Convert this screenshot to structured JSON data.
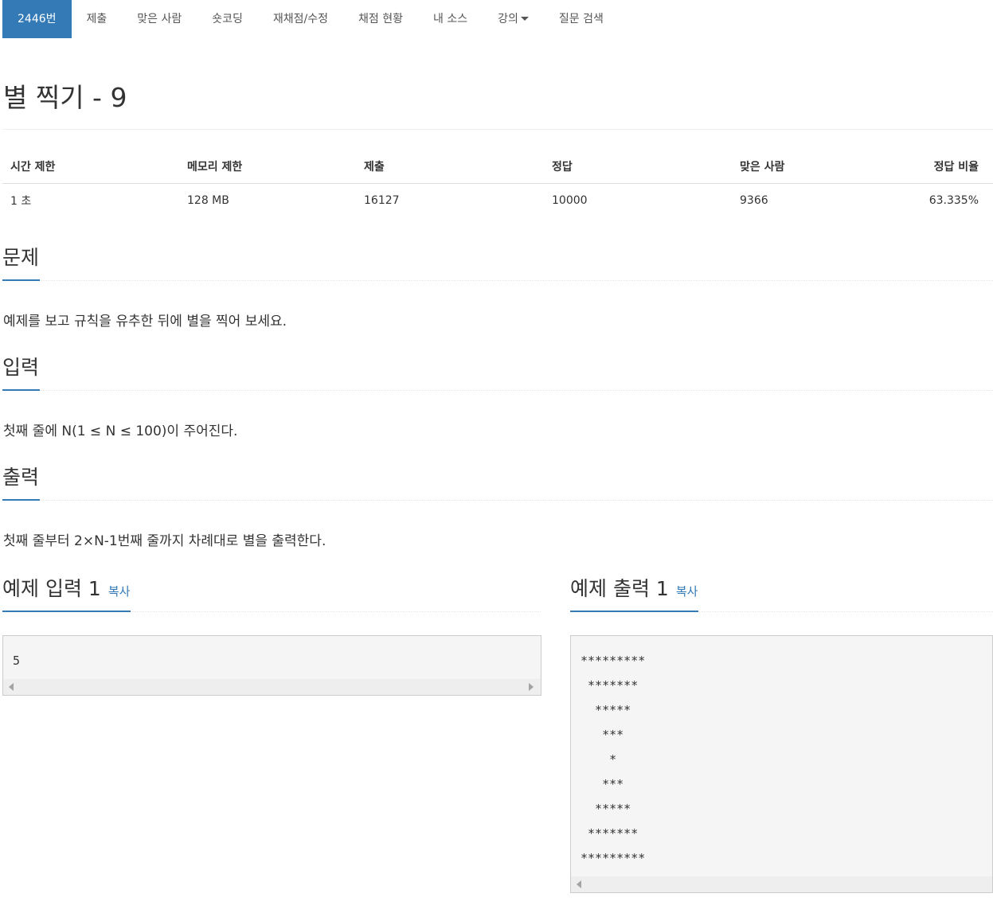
{
  "nav": {
    "tabs": [
      {
        "label": "2446번"
      },
      {
        "label": "제출"
      },
      {
        "label": "맞은 사람"
      },
      {
        "label": "숏코딩"
      },
      {
        "label": "재채점/수정"
      },
      {
        "label": "채점 현황"
      },
      {
        "label": "내 소스"
      },
      {
        "label": "강의"
      },
      {
        "label": "질문 검색"
      }
    ]
  },
  "problem": {
    "title": "별 찍기 - 9"
  },
  "info_table": {
    "headers": [
      "시간 제한",
      "메모리 제한",
      "제출",
      "정답",
      "맞은 사람",
      "정답 비율"
    ],
    "values": [
      "1 초",
      "128 MB",
      "16127",
      "10000",
      "9366",
      "63.335%"
    ]
  },
  "sections": {
    "description": {
      "heading": "문제",
      "text": "예제를 보고 규칙을 유추한 뒤에 별을 찍어 보세요."
    },
    "input": {
      "heading": "입력",
      "text": "첫째 줄에 N(1 ≤ N ≤ 100)이 주어진다."
    },
    "output": {
      "heading": "출력",
      "text": "첫째 줄부터 2×N-1번째 줄까지 차례대로 별을 출력한다."
    }
  },
  "samples": {
    "input": {
      "heading": "예제 입력 1",
      "copy_label": "복사",
      "content": "5"
    },
    "output": {
      "heading": "예제 출력 1",
      "copy_label": "복사",
      "content": "*********\n *******\n  *****\n   ***\n    *\n   ***\n  *****\n *******\n*********"
    }
  },
  "colors": {
    "accent": "#337ab7",
    "nav_active_bg": "#337ab7",
    "sample_bg": "#f5f5f5"
  }
}
